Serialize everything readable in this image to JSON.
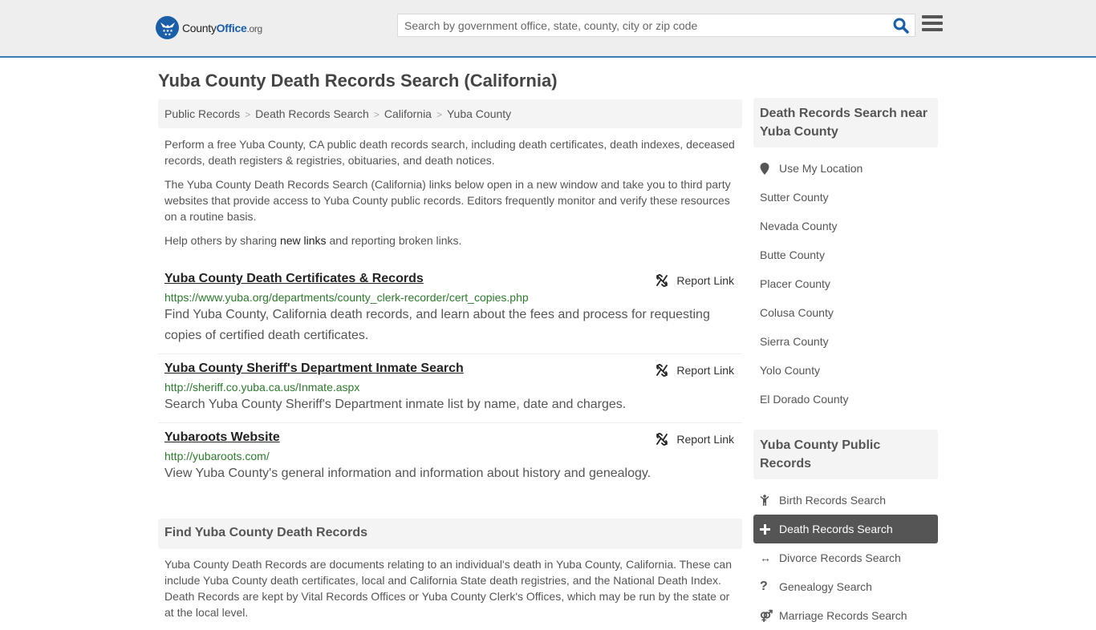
{
  "header": {
    "logo": {
      "name_part1": "County",
      "name_part2": "Office",
      "name_part3": ".org"
    },
    "search": {
      "placeholder": "Search by government office, state, county, city or zip code",
      "value": ""
    },
    "colors": {
      "brand": "#1b5ea8",
      "border": "#3a7db5"
    }
  },
  "page": {
    "title": "Yuba County Death Records Search (California)",
    "breadcrumb": [
      "Public Records",
      "Death Records Search",
      "California",
      "Yuba County"
    ],
    "intro": {
      "p1": "Perform a free Yuba County, CA public death records search, including death certificates, death indexes, deceased records, death registers & registries, obituaries, and death notices.",
      "p2": "The Yuba County Death Records Search (California) links below open in a new window and take you to third party websites that provide access to Yuba County public records. Editors frequently monitor and verify these resources on a routine basis.",
      "p3_before": "Help others by sharing ",
      "p3_link": "new links",
      "p3_after": " and reporting broken links."
    },
    "report_label": "Report Link",
    "links": [
      {
        "title": "Yuba County Death Certificates & Records",
        "url": "https://www.yuba.org/departments/county_clerk-recorder/cert_copies.php",
        "desc": "Find Yuba County, California death records, and learn about the fees and process for requesting copies of certified death certificates."
      },
      {
        "title": "Yuba County Sheriff's Department Inmate Search",
        "url": "http://sheriff.co.yuba.ca.us/Inmate.aspx",
        "desc": "Search Yuba County Sheriff's Department inmate list by name, date and charges."
      },
      {
        "title": "Yubaroots Website",
        "url": "http://yubaroots.com/",
        "desc": "View Yuba County's general information and information about history and genealogy."
      }
    ],
    "find": {
      "heading": "Find Yuba County Death Records",
      "body": "Yuba County Death Records are documents relating to an individual's death in Yuba County, California. These can include Yuba County death certificates, local and California State death registries, and the National Death Index. Death Records are kept by Vital Records Offices or Yuba County Clerk's Offices, which may be run by the state or at the local level."
    }
  },
  "sidebar": {
    "nearby": {
      "heading": "Death Records Search near Yuba County",
      "use_location": "Use My Location",
      "counties": [
        "Sutter County",
        "Nevada County",
        "Butte County",
        "Placer County",
        "Colusa County",
        "Sierra County",
        "Yolo County",
        "El Dorado County"
      ]
    },
    "public_records": {
      "heading": "Yuba County Public Records",
      "items": [
        {
          "label": "Birth Records Search",
          "icon": "child-icon",
          "active": false
        },
        {
          "label": "Death Records Search",
          "icon": "plus-icon",
          "active": true
        },
        {
          "label": "Divorce Records Search",
          "icon": "arrows-horizontal-icon",
          "active": false
        },
        {
          "label": "Genealogy Search",
          "icon": "question-icon",
          "active": false
        },
        {
          "label": "Marriage Records Search",
          "icon": "marriage-icon",
          "active": false
        }
      ]
    }
  }
}
